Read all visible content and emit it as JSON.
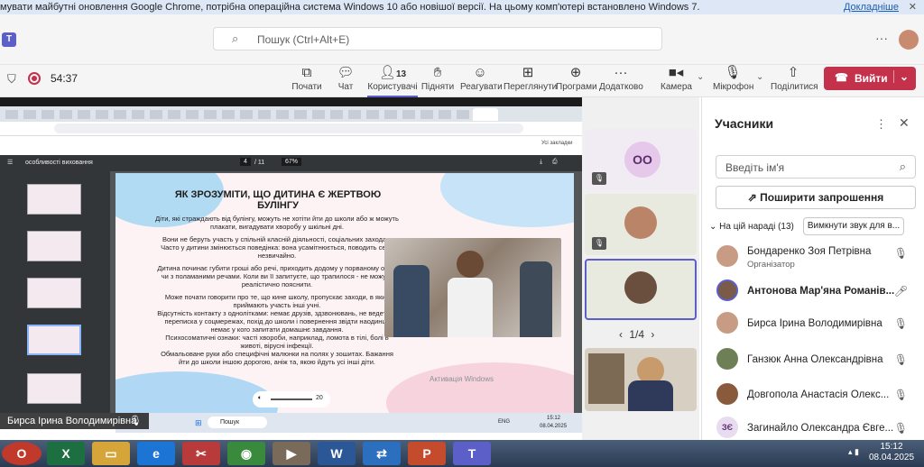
{
  "banner": {
    "text": "мувати майбутні оновлення Google Chrome, потрібна операційна система Windows 10 або новішої версії. На цьому комп'ютері встановлено Windows 7.",
    "link": "Докладніше"
  },
  "search": {
    "placeholder": "Пошук (Ctrl+Alt+E)"
  },
  "meeting": {
    "timer": "54:37"
  },
  "toolbar": {
    "chat": "Почати",
    "chat2": "Чат",
    "people": "Користувачі",
    "people_count": "13",
    "raise": "Підняти",
    "react": "Реагувати",
    "view": "Переглянути",
    "apps": "Програми",
    "more": "Додатково",
    "camera": "Камера",
    "mic": "Мікрофон",
    "share": "Поділитися",
    "leave": "Вийти"
  },
  "shared": {
    "pdf_title": "особливості виховання",
    "page": "4",
    "pages": "/ 11",
    "zoom": "67%",
    "bookmarks": "Усі закладки",
    "slide_title": "ЯК ЗРОЗУМІТИ, ЩО ДИТИНА Є ЖЕРТВОЮ БУЛІНГУ",
    "para1": "Діти, які страждають від булінгу, можуть не хотіти йти до школи або ж можуть плакати, вигадувати хворобу у шкільні дні.",
    "para2": "Вони не беруть участь у спільній класній діяльності, соціальних заходах.",
    "para3": "Часто у дитини змінюється поведінка: вона усамітнюється, поводить себе незвичайно.",
    "para4": "Дитина починає губити гроші або речі, приходить додому у порваному одязі чи з поламаними речами. Коли ви її запитуєте, що трапилося - не можуть реалістично пояснити.",
    "para5": "Може почати говорити про те, що кине школу, пропускає заходи, в яких приймають участь інші учні.",
    "para6": "Відсутність контакту з однолітками: немає друзів, здзвонювань, не ведеться переписка у соцмережах, похід до школи і повернення звідти наодинці, немає у кого запитати домашнє завдання.",
    "para7": "Психосоматичні ознаки: часті хвороби, наприклад, ломота в тілі, болі в животі, вірусні інфекції.",
    "para8": "Обмальоване руки або специфічні малюнки на полях у зошитах. Бажання йти до школи іншою дорогою, аніж та, якою йдуть усі інші діти.",
    "watermark": "Активація Windows",
    "zoom_val": "20",
    "win_search": "Пошук",
    "win_lang": "ENG",
    "win_time": "15:12",
    "win_date": "08.04.2025",
    "presenter": "Бирса Ірина Володимирівна"
  },
  "videos": {
    "oo_initials": "OO",
    "pager": "1/4"
  },
  "participants": {
    "title": "Учасники",
    "input_placeholder": "Введіть ім'я",
    "invite": "Поширити запрошення",
    "section": "На цій нараді (13)",
    "mute_all": "Вимкнути звук для в...",
    "list": [
      {
        "name": "Бондаренко Зоя Петрівна",
        "role": "Організатор"
      },
      {
        "name": "Антонова Мар'яна Романів...",
        "role": ""
      },
      {
        "name": "Бирса Ірина Володимирівна",
        "role": ""
      },
      {
        "name": "Ганзюк Анна Олександрівна",
        "role": ""
      },
      {
        "name": "Довгопола Анастасія Олекс...",
        "role": ""
      },
      {
        "name": "Загинайло Олександра Євге...",
        "role": "",
        "initials": "ЗЄ"
      }
    ]
  },
  "taskbar": {
    "time": "15:12",
    "date": "08.04.2025"
  }
}
